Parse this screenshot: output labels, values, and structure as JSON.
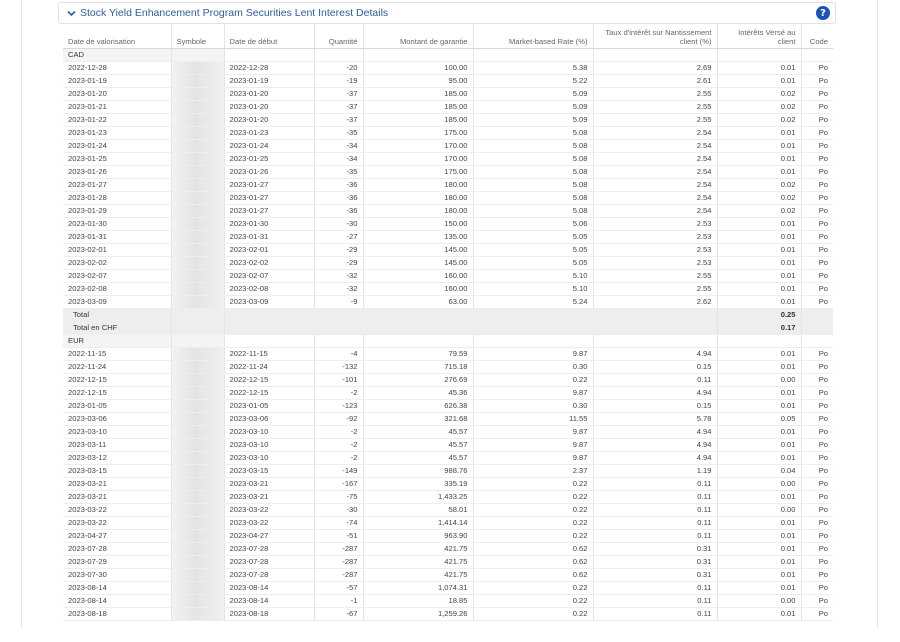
{
  "panel": {
    "title": "Stock Yield Enhancement Program Securities Lent Interest Details",
    "help_label": "?"
  },
  "columns": [
    "Date de valorisation",
    "Symbole",
    "Date de début",
    "Quantité",
    "Montant de garantie",
    "Market-based Rate (%)",
    "Taux d'intérêt sur Nantissement client (%)",
    "Intérêts Versé au client",
    "Code"
  ],
  "groups": [
    {
      "currency": "CAD",
      "rows": [
        [
          "2022-12-28",
          "2022-12-28",
          "-20",
          "100.00",
          "5.38",
          "2.69",
          "0.01",
          "Po"
        ],
        [
          "2023-01-19",
          "2023-01-19",
          "-19",
          "95.00",
          "5.22",
          "2.61",
          "0.01",
          "Po"
        ],
        [
          "2023-01-20",
          "2023-01-20",
          "-37",
          "185.00",
          "5.09",
          "2.55",
          "0.02",
          "Po"
        ],
        [
          "2023-01-21",
          "2023-01-20",
          "-37",
          "185.00",
          "5.09",
          "2.55",
          "0.02",
          "Po"
        ],
        [
          "2023-01-22",
          "2023-01-20",
          "-37",
          "185.00",
          "5.09",
          "2.55",
          "0.02",
          "Po"
        ],
        [
          "2023-01-23",
          "2023-01-23",
          "-35",
          "175.00",
          "5.08",
          "2.54",
          "0.01",
          "Po"
        ],
        [
          "2023-01-24",
          "2023-01-24",
          "-34",
          "170.00",
          "5.08",
          "2.54",
          "0.01",
          "Po"
        ],
        [
          "2023-01-25",
          "2023-01-25",
          "-34",
          "170.00",
          "5.08",
          "2.54",
          "0.01",
          "Po"
        ],
        [
          "2023-01-26",
          "2023-01-26",
          "-35",
          "175.00",
          "5.08",
          "2.54",
          "0.01",
          "Po"
        ],
        [
          "2023-01-27",
          "2023-01-27",
          "-36",
          "180.00",
          "5.08",
          "2.54",
          "0.02",
          "Po"
        ],
        [
          "2023-01-28",
          "2023-01-27",
          "-36",
          "180.00",
          "5.08",
          "2.54",
          "0.02",
          "Po"
        ],
        [
          "2023-01-29",
          "2023-01-27",
          "-36",
          "180.00",
          "5.08",
          "2.54",
          "0.02",
          "Po"
        ],
        [
          "2023-01-30",
          "2023-01-30",
          "-30",
          "150.00",
          "5.06",
          "2.53",
          "0.01",
          "Po"
        ],
        [
          "2023-01-31",
          "2023-01-31",
          "-27",
          "135.00",
          "5.05",
          "2.53",
          "0.01",
          "Po"
        ],
        [
          "2023-02-01",
          "2023-02-01",
          "-29",
          "145.00",
          "5.05",
          "2.53",
          "0.01",
          "Po"
        ],
        [
          "2023-02-02",
          "2023-02-02",
          "-29",
          "145.00",
          "5.05",
          "2.53",
          "0.01",
          "Po"
        ],
        [
          "2023-02-07",
          "2023-02-07",
          "-32",
          "160.00",
          "5.10",
          "2.55",
          "0.01",
          "Po"
        ],
        [
          "2023-02-08",
          "2023-02-08",
          "-32",
          "160.00",
          "5.10",
          "2.55",
          "0.01",
          "Po"
        ],
        [
          "2023-03-09",
          "2023-03-09",
          "-9",
          "63.00",
          "5.24",
          "2.62",
          "0.01",
          "Po"
        ]
      ],
      "total_label": "Total",
      "total_value": "0.25",
      "total_chf_label": "Total en CHF",
      "total_chf_value": "0.17"
    },
    {
      "currency": "EUR",
      "rows": [
        [
          "2022-11-15",
          "2022-11-15",
          "-4",
          "79.59",
          "9.87",
          "4.94",
          "0.01",
          "Po"
        ],
        [
          "2022-11-24",
          "2022-11-24",
          "-132",
          "715.18",
          "0.30",
          "0.15",
          "0.01",
          "Po"
        ],
        [
          "2022-12-15",
          "2022-12-15",
          "-101",
          "276.69",
          "0.22",
          "0.11",
          "0.00",
          "Po"
        ],
        [
          "2022-12-15",
          "2022-12-15",
          "-2",
          "45.36",
          "9.87",
          "4.94",
          "0.01",
          "Po"
        ],
        [
          "2023-01-05",
          "2023-01-05",
          "-123",
          "626.38",
          "0.30",
          "0.15",
          "0.01",
          "Po"
        ],
        [
          "2023-03-06",
          "2023-03-06",
          "-92",
          "321.68",
          "11.55",
          "5.78",
          "0.05",
          "Po"
        ],
        [
          "2023-03-10",
          "2023-03-10",
          "-2",
          "45.57",
          "9.87",
          "4.94",
          "0.01",
          "Po"
        ],
        [
          "2023-03-11",
          "2023-03-10",
          "-2",
          "45.57",
          "9.87",
          "4.94",
          "0.01",
          "Po"
        ],
        [
          "2023-03-12",
          "2023-03-10",
          "-2",
          "45.57",
          "9.87",
          "4.94",
          "0.01",
          "Po"
        ],
        [
          "2023-03-15",
          "2023-03-15",
          "-149",
          "988.76",
          "2.37",
          "1.19",
          "0.04",
          "Po"
        ],
        [
          "2023-03-21",
          "2023-03-21",
          "-167",
          "335.19",
          "0.22",
          "0.11",
          "0.00",
          "Po"
        ],
        [
          "2023-03-21",
          "2023-03-21",
          "-75",
          "1,433.25",
          "0.22",
          "0.11",
          "0.01",
          "Po"
        ],
        [
          "2023-03-22",
          "2023-03-22",
          "-30",
          "58.01",
          "0.22",
          "0.11",
          "0.00",
          "Po"
        ],
        [
          "2023-03-22",
          "2023-03-22",
          "-74",
          "1,414.14",
          "0.22",
          "0.11",
          "0.01",
          "Po"
        ],
        [
          "2023-04-27",
          "2023-04-27",
          "-51",
          "963.90",
          "0.22",
          "0.11",
          "0.01",
          "Po"
        ],
        [
          "2023-07-28",
          "2023-07-28",
          "-287",
          "421.75",
          "0.62",
          "0.31",
          "0.01",
          "Po"
        ],
        [
          "2023-07-29",
          "2023-07-28",
          "-287",
          "421.75",
          "0.62",
          "0.31",
          "0.01",
          "Po"
        ],
        [
          "2023-07-30",
          "2023-07-28",
          "-287",
          "421.75",
          "0.62",
          "0.31",
          "0.01",
          "Po"
        ],
        [
          "2023-08-14",
          "2023-08-14",
          "-57",
          "1,074.31",
          "0.22",
          "0.11",
          "0.01",
          "Po"
        ],
        [
          "2023-08-14",
          "2023-08-14",
          "-1",
          "18.85",
          "0.22",
          "0.11",
          "0.00",
          "Po"
        ],
        [
          "2023-08-18",
          "2023-08-18",
          "-67",
          "1,259.26",
          "0.22",
          "0.11",
          "0.01",
          "Po"
        ]
      ]
    }
  ]
}
